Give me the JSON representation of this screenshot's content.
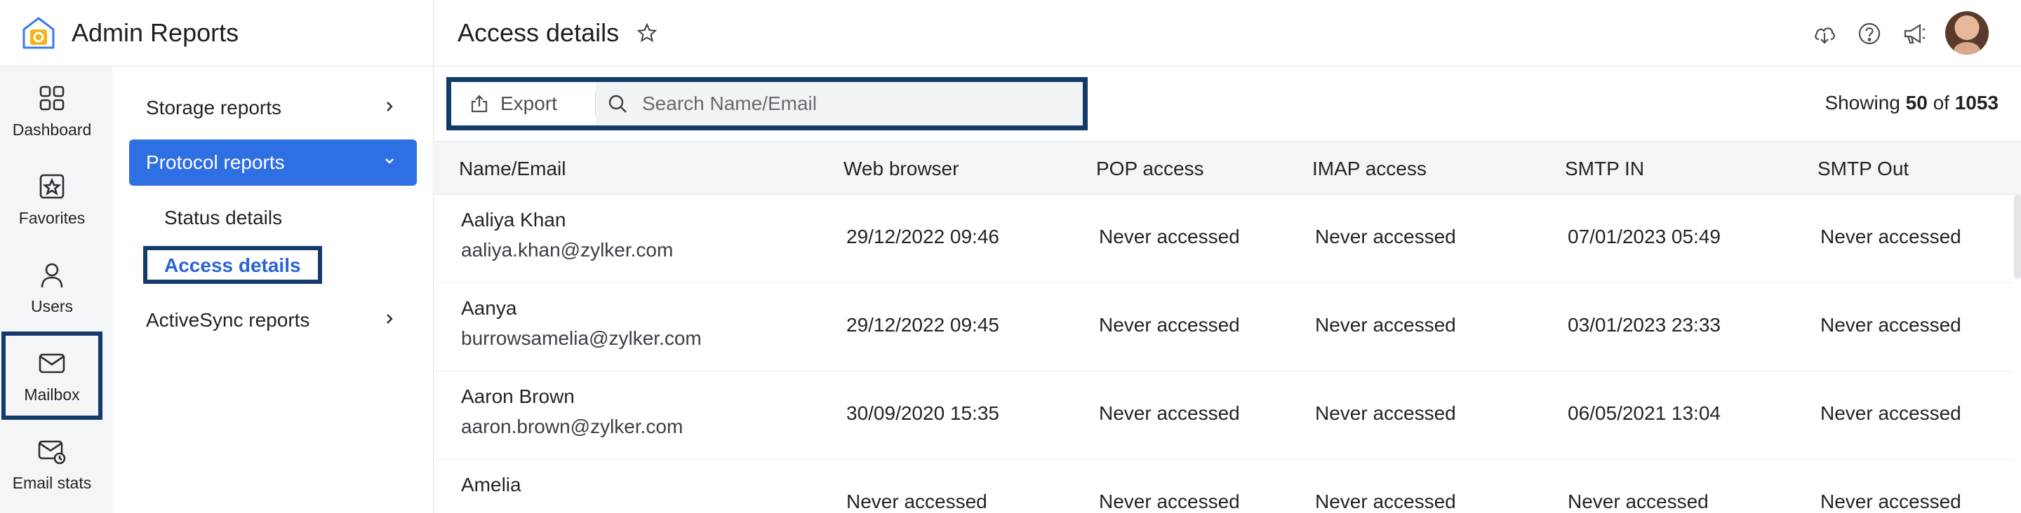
{
  "app": {
    "title": "Admin Reports"
  },
  "rail": [
    {
      "label": "Dashboard",
      "icon": "dashboard-grid-icon"
    },
    {
      "label": "Favorites",
      "icon": "favorites-star-icon"
    },
    {
      "label": "Users",
      "icon": "user-icon"
    },
    {
      "label": "Mailbox",
      "icon": "mailbox-icon",
      "active": true
    },
    {
      "label": "Email stats",
      "icon": "email-stats-icon"
    }
  ],
  "submenu": {
    "storage": "Storage reports",
    "protocol": "Protocol reports",
    "status": "Status details",
    "access": "Access details",
    "activesync": "ActiveSync reports"
  },
  "header": {
    "title": "Access details"
  },
  "toolbar": {
    "export_label": "Export",
    "search_placeholder": "Search Name/Email",
    "showing_prefix": "Showing",
    "showing_count": "50",
    "showing_of": "of",
    "showing_total": "1053"
  },
  "table": {
    "columns": [
      "Name/Email",
      "Web browser",
      "POP access",
      "IMAP access",
      "SMTP IN",
      "SMTP Out"
    ],
    "rows": [
      {
        "name": "Aaliya Khan",
        "email": "aaliya.khan@zylker.com",
        "web": "29/12/2022 09:46",
        "pop": "Never accessed",
        "imap": "Never accessed",
        "smtp_in": "07/01/2023 05:49",
        "smtp_out": "Never accessed"
      },
      {
        "name": "Aanya",
        "email": "burrowsamelia@zylker.com",
        "web": "29/12/2022 09:45",
        "pop": "Never accessed",
        "imap": "Never accessed",
        "smtp_in": "03/01/2023 23:33",
        "smtp_out": "Never accessed"
      },
      {
        "name": "Aaron Brown",
        "email": "aaron.brown@zylker.com",
        "web": "30/09/2020 15:35",
        "pop": "Never accessed",
        "imap": "Never accessed",
        "smtp_in": "06/05/2021 13:04",
        "smtp_out": "Never accessed"
      },
      {
        "name": "Amelia",
        "email": "",
        "web": "Never accessed",
        "pop": "Never accessed",
        "imap": "Never accessed",
        "smtp_in": "Never accessed",
        "smtp_out": "Never accessed"
      }
    ]
  },
  "colors": {
    "accent": "#2f6fe4",
    "highlight_border": "#123a6b",
    "link": "#2a62d6"
  }
}
